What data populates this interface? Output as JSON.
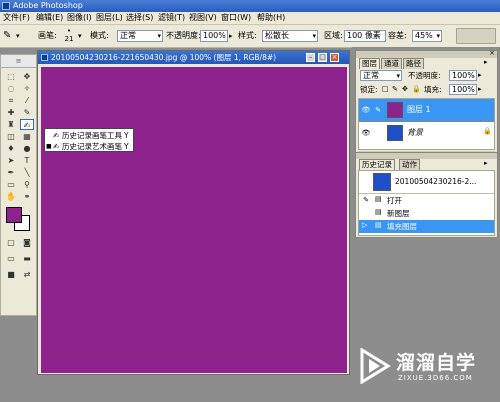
{
  "window": {
    "title": "Adobe Photoshop"
  },
  "menu": [
    "文件(F)",
    "编辑(E)",
    "图像(I)",
    "图层(L)",
    "选择(S)",
    "滤镜(T)",
    "视图(V)",
    "窗口(W)",
    "帮助(H)"
  ],
  "options": {
    "brush_label": "画笔:",
    "brush_size": "21",
    "mode_label": "模式:",
    "mode_value": "正常",
    "opacity_label": "不透明度:",
    "opacity_value": "100%",
    "style_label": "样式:",
    "style_value": "松散长",
    "area_label": "区域:",
    "area_value": "100 像素",
    "tolerance_label": "容差:",
    "tolerance_value": "45%"
  },
  "document": {
    "title": "20100504230216-221650430.jpg @ 100% (图层 1, RGB/8#)",
    "fill_color": "#8e238e"
  },
  "tool_popup": {
    "items": [
      {
        "label": "历史记录画笔工具",
        "shortcut": "Y"
      },
      {
        "label": "历史记录艺术画笔",
        "shortcut": "Y"
      }
    ]
  },
  "layers_panel": {
    "tabs": [
      "图层",
      "通道",
      "路径"
    ],
    "blend_mode": "正常",
    "opacity_label": "不透明度:",
    "opacity_value": "100%",
    "lock_label": "锁定:",
    "fill_label": "填充:",
    "fill_value": "100%",
    "layers": [
      {
        "name": "图层 1",
        "selected": true,
        "thumb_color": "#8e238e"
      },
      {
        "name": "背景",
        "selected": false,
        "thumb_color": "#1f4fc8"
      }
    ]
  },
  "history_panel": {
    "tabs": [
      "历史记录",
      "动作"
    ],
    "snapshot": "20100504230216-2...",
    "states": [
      {
        "label": "打开",
        "selected": false
      },
      {
        "label": "新图层",
        "selected": false
      },
      {
        "label": "填充图层",
        "selected": true
      }
    ]
  },
  "watermark": {
    "name": "溜溜自学",
    "url": "ZIXUE.3D66.COM"
  },
  "colors": {
    "foreground": "#8e238e",
    "background": "#ffffff",
    "selection": "#3a96f5"
  }
}
